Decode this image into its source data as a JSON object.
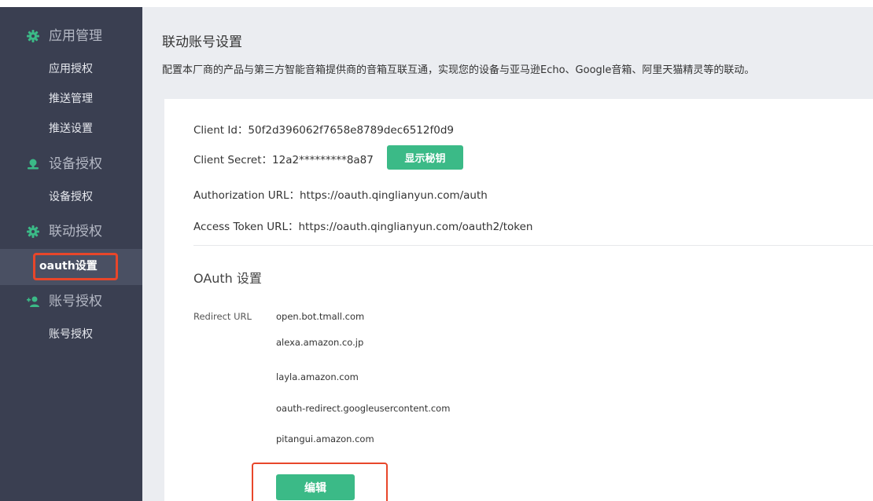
{
  "sidebar": {
    "groups": [
      {
        "label": "应用管理",
        "icon": "gear-icon",
        "items": [
          "应用授权",
          "推送管理",
          "推送设置"
        ]
      },
      {
        "label": "设备授权",
        "icon": "device-icon",
        "items": [
          "设备授权"
        ]
      },
      {
        "label": "联动授权",
        "icon": "gear-icon",
        "items": [
          "oauth设置"
        ]
      },
      {
        "label": "账号授权",
        "icon": "user-add-icon",
        "items": [
          "账号授权"
        ]
      }
    ],
    "active_item": "oauth设置"
  },
  "header": {
    "title": "联动账号设置",
    "description": "配置本厂商的产品与第三方智能音箱提供商的音箱互联互通，实现您的设备与亚马逊Echo、Google音箱、阿里天猫精灵等的联动。"
  },
  "credentials": {
    "client_id": "Client Id：50f2d396062f7658e8789dec6512f0d9",
    "client_secret": "Client Secret：12a2*********8a87",
    "show_secret_button": "显示秘钥",
    "authorization_url": "Authorization URL：https://oauth.qinglianyun.com/auth",
    "access_token_url": "Access Token URL：https://oauth.qinglianyun.com/oauth2/token"
  },
  "oauth": {
    "section_title": "OAuth 设置",
    "redirect_label": "Redirect URL",
    "redirect_urls": [
      "open.bot.tmall.com",
      "alexa.amazon.co.jp",
      "layla.amazon.com",
      "oauth-redirect.googleusercontent.com",
      "pitangui.amazon.com"
    ],
    "edit_button": "编辑"
  },
  "colors": {
    "sidebar_bg": "#3a3f51",
    "accent_green": "#3bba87",
    "highlight_red": "#e8462a",
    "content_bg": "#ebedf1"
  }
}
